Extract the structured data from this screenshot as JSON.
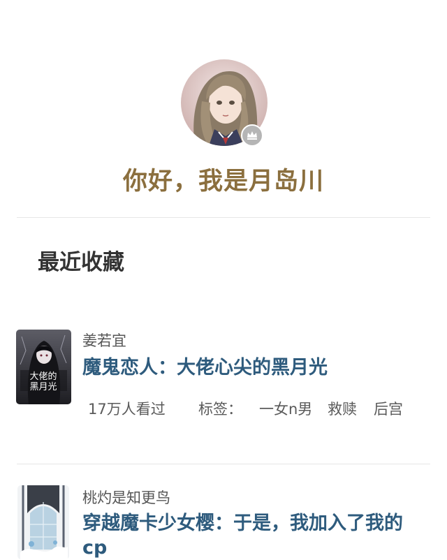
{
  "profile": {
    "greeting": "你好，我是月岛川",
    "avatar_icon": "user-avatar",
    "badge_icon": "crown-icon"
  },
  "section": {
    "title": "最近收藏"
  },
  "books": [
    {
      "author": "姜若宜",
      "title": "魔鬼恋人：大佬心尖的黑月光",
      "cover_text": "大佬的黑月光",
      "views": "17万人看过",
      "tag_label": "标签：",
      "tags": [
        "一女n男",
        "救赎",
        "后宫"
      ]
    },
    {
      "author": "桃灼是知更鸟",
      "title": "穿越魔卡少女樱：于是，我加入了我的cp"
    }
  ],
  "colors": {
    "greeting": "#8b6f3e",
    "title_link": "#2e5b7d",
    "divider": "#e6e6e6"
  }
}
